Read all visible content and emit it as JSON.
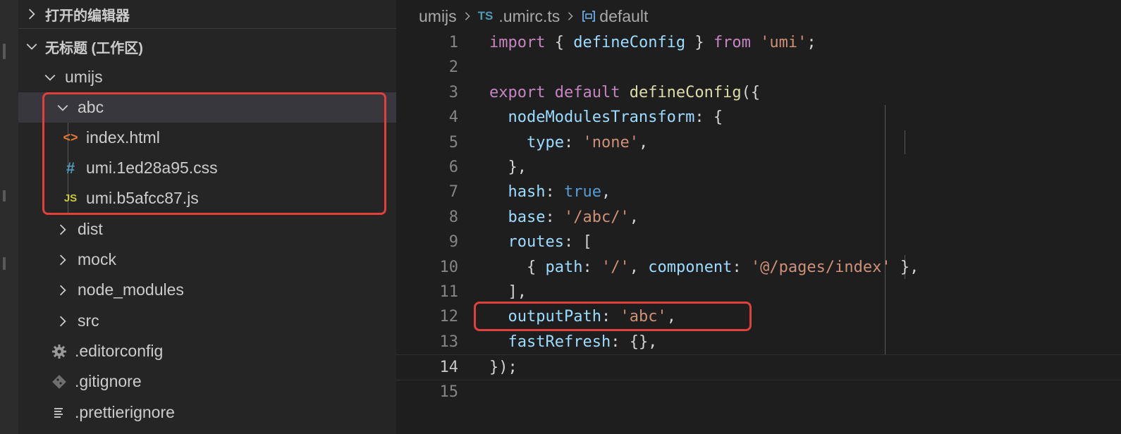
{
  "sidebar": {
    "open_editors_label": "打开的编辑器",
    "workspace_label": "无标题 (工作区)",
    "tree": [
      {
        "label": "umijs",
        "kind": "folder-open"
      },
      {
        "label": "abc",
        "kind": "folder-open"
      },
      {
        "label": "index.html",
        "kind": "html",
        "icon": "<>"
      },
      {
        "label": "umi.1ed28a95.css",
        "kind": "css",
        "icon": "#"
      },
      {
        "label": "umi.b5afcc87.js",
        "kind": "js",
        "icon": "JS"
      },
      {
        "label": "dist",
        "kind": "folder-closed"
      },
      {
        "label": "mock",
        "kind": "folder-closed"
      },
      {
        "label": "node_modules",
        "kind": "folder-closed"
      },
      {
        "label": "src",
        "kind": "folder-closed"
      },
      {
        "label": ".editorconfig",
        "kind": "config",
        "icon": "gear-icon"
      },
      {
        "label": ".gitignore",
        "kind": "git",
        "icon": "git-icon"
      },
      {
        "label": ".prettierignore",
        "kind": "text",
        "icon": "lines-icon"
      }
    ]
  },
  "breadcrumb": {
    "folder": "umijs",
    "file_icon": "TS",
    "file": ".umirc.ts",
    "symbol": "default"
  },
  "editor": {
    "current_line": 14,
    "lines": [
      {
        "n": "1",
        "tokens": [
          [
            "kw",
            "import"
          ],
          [
            "pl",
            " { "
          ],
          [
            "var",
            "defineConfig"
          ],
          [
            "pl",
            " } "
          ],
          [
            "kw",
            "from"
          ],
          [
            "pl",
            " "
          ],
          [
            "str",
            "'umi'"
          ],
          [
            "pl",
            ";"
          ]
        ]
      },
      {
        "n": "2",
        "tokens": []
      },
      {
        "n": "3",
        "tokens": [
          [
            "kw",
            "export"
          ],
          [
            "pl",
            " "
          ],
          [
            "kw",
            "default"
          ],
          [
            "pl",
            " "
          ],
          [
            "fn",
            "defineConfig"
          ],
          [
            "pl",
            "({"
          ]
        ]
      },
      {
        "n": "4",
        "tokens": [
          [
            "pl",
            "  "
          ],
          [
            "var",
            "nodeModulesTransform"
          ],
          [
            "pl",
            ": {"
          ]
        ]
      },
      {
        "n": "5",
        "tokens": [
          [
            "pl",
            "    "
          ],
          [
            "var",
            "type"
          ],
          [
            "pl",
            ": "
          ],
          [
            "str",
            "'none'"
          ],
          [
            "pl",
            ","
          ]
        ]
      },
      {
        "n": "6",
        "tokens": [
          [
            "pl",
            "  },"
          ]
        ]
      },
      {
        "n": "7",
        "tokens": [
          [
            "pl",
            "  "
          ],
          [
            "var",
            "hash"
          ],
          [
            "pl",
            ": "
          ],
          [
            "bool",
            "true"
          ],
          [
            "pl",
            ","
          ]
        ]
      },
      {
        "n": "8",
        "tokens": [
          [
            "pl",
            "  "
          ],
          [
            "var",
            "base"
          ],
          [
            "pl",
            ": "
          ],
          [
            "str",
            "'/abc/'"
          ],
          [
            "pl",
            ","
          ]
        ]
      },
      {
        "n": "9",
        "tokens": [
          [
            "pl",
            "  "
          ],
          [
            "var",
            "routes"
          ],
          [
            "pl",
            ": ["
          ]
        ]
      },
      {
        "n": "10",
        "tokens": [
          [
            "pl",
            "    { "
          ],
          [
            "var",
            "path"
          ],
          [
            "pl",
            ": "
          ],
          [
            "str",
            "'/'"
          ],
          [
            "pl",
            ", "
          ],
          [
            "var",
            "component"
          ],
          [
            "pl",
            ": "
          ],
          [
            "str",
            "'@/pages/index'"
          ],
          [
            "pl",
            " },"
          ]
        ]
      },
      {
        "n": "11",
        "tokens": [
          [
            "pl",
            "  ],"
          ]
        ]
      },
      {
        "n": "12",
        "tokens": [
          [
            "pl",
            "  "
          ],
          [
            "var",
            "outputPath"
          ],
          [
            "pl",
            ": "
          ],
          [
            "str",
            "'abc'"
          ],
          [
            "pl",
            ","
          ]
        ]
      },
      {
        "n": "13",
        "tokens": [
          [
            "pl",
            "  "
          ],
          [
            "var",
            "fastRefresh"
          ],
          [
            "pl",
            ": {},"
          ]
        ]
      },
      {
        "n": "14",
        "tokens": [
          [
            "pl",
            "});"
          ]
        ]
      },
      {
        "n": "15",
        "tokens": []
      }
    ]
  },
  "colors": {
    "highlight": "#e0403a",
    "html_icon": "#e37933",
    "css_icon": "#519aba",
    "js_icon": "#cbcb41",
    "ts_icon": "#519aba"
  }
}
